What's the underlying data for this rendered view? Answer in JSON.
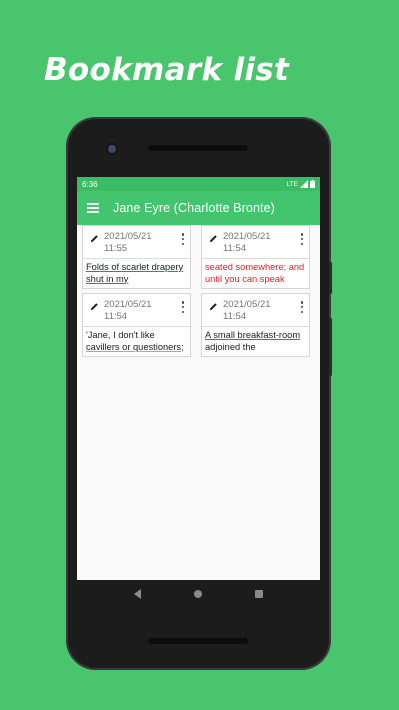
{
  "promo": {
    "headline": "Bookmark list",
    "background_color": "#49c66d"
  },
  "status_bar": {
    "time": "6:36",
    "network": "LTE"
  },
  "toolbar": {
    "title": "Jane Eyre (Charlotte Bronte)",
    "menu_icon": "hamburger-menu-icon",
    "color": "#44c46f"
  },
  "bookmarks": [
    {
      "date": "2021/05/21",
      "time": "11:55",
      "text_line1": "Folds of scarlet drapery",
      "text_line2": "shut in my",
      "style": "normal"
    },
    {
      "date": "2021/05/21",
      "time": "11:54",
      "text_line1": "seated somewhere; and",
      "text_line2": "until you can speak",
      "style": "red"
    },
    {
      "date": "2021/05/21",
      "time": "11:54",
      "text_line1": "'Jane, I don't like",
      "text_line2": "cavillers or questioners;",
      "style": "normal"
    },
    {
      "date": "2021/05/21",
      "time": "11:54",
      "text_line1": "A small breakfast-room",
      "text_line2": "adjoined the",
      "style": "normal"
    }
  ],
  "nav_bar": {
    "back_icon": "back-triangle-icon",
    "home_icon": "home-circle-icon",
    "recents_icon": "recents-square-icon"
  }
}
